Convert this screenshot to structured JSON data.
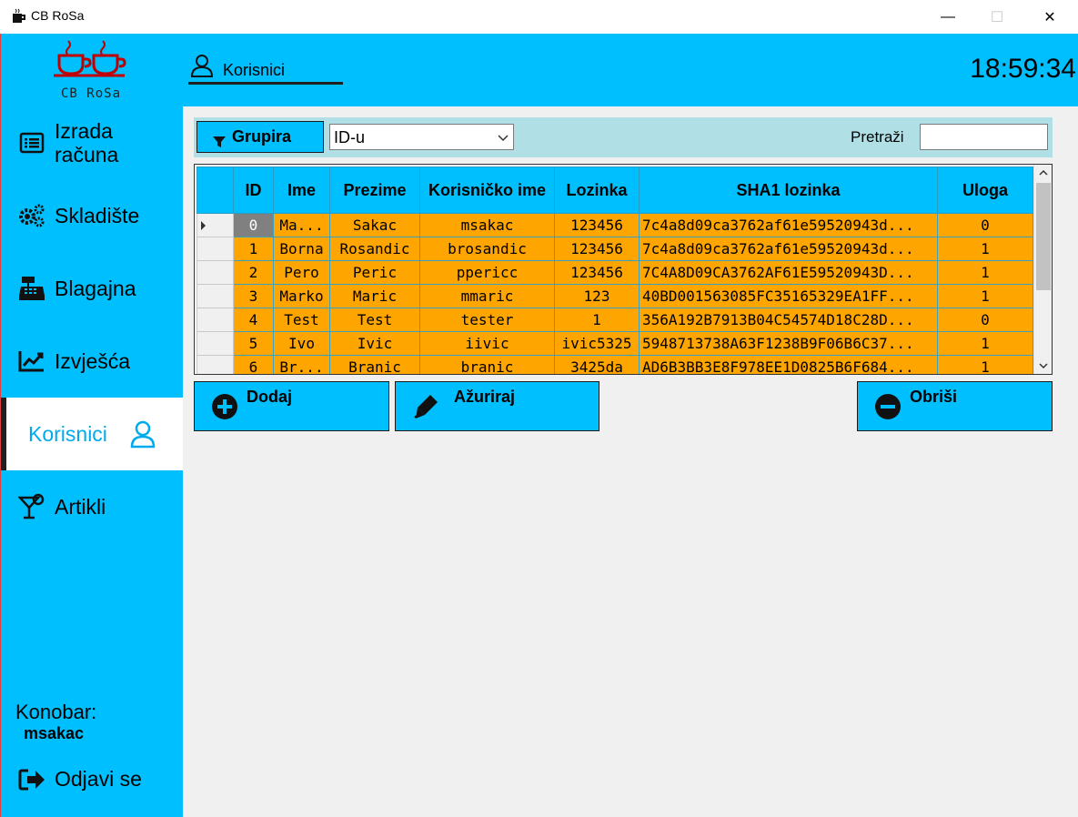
{
  "window": {
    "title": "CB RoSa",
    "minimize": "—",
    "maximize": "☐",
    "close": "✕"
  },
  "sidebar": {
    "logo_text": "CB RoSa",
    "items": [
      {
        "label_line1": "Izrada",
        "label_line2": "računa",
        "icon": "receipt-list-icon"
      },
      {
        "label": "Skladište",
        "icon": "gears-icon"
      },
      {
        "label": "Blagajna",
        "icon": "cash-register-icon"
      },
      {
        "label": "Izvješća",
        "icon": "line-chart-icon"
      },
      {
        "label": "Korisnici",
        "icon": "user-icon",
        "active": true
      },
      {
        "label": "Artikli",
        "icon": "cocktail-glass-icon"
      }
    ],
    "waiter_label": "Konobar:",
    "waiter_name": "msakac",
    "logout_label": "Odjavi se"
  },
  "header": {
    "page_title": "Korisnici",
    "clock": "18:59:34"
  },
  "filter": {
    "group_label": "Grupira",
    "group_by_value": "ID-u",
    "search_label": "Pretraži",
    "search_value": ""
  },
  "table": {
    "columns": [
      "ID",
      "Ime",
      "Prezime",
      "Korisničko ime",
      "Lozinka",
      "SHA1 lozinka",
      "Uloga"
    ],
    "rows": [
      [
        "0",
        "Ma...",
        "Sakac",
        "msakac",
        "123456",
        "7c4a8d09ca3762af61e59520943d...",
        "0"
      ],
      [
        "1",
        "Borna",
        "Rosandic",
        "brosandic",
        "123456",
        "7c4a8d09ca3762af61e59520943d...",
        "1"
      ],
      [
        "2",
        "Pero",
        "Peric",
        "ppericc",
        "123456",
        "7C4A8D09CA3762AF61E59520943D...",
        "1"
      ],
      [
        "3",
        "Marko",
        "Maric",
        "mmaric",
        "123",
        "40BD001563085FC35165329EA1FF...",
        "1"
      ],
      [
        "4",
        "Test",
        "Test",
        "tester",
        "1",
        "356A192B7913B04C54574D18C28D...",
        "0"
      ],
      [
        "5",
        "Ivo",
        "Ivic",
        "iivic",
        "ivic5325",
        "5948713738A63F1238B9F06B6C37...",
        "1"
      ],
      [
        "6",
        "Br...",
        "Branic",
        "branic",
        "3425da",
        "AD6B3BB3E8F978EE1D0825B6F684...",
        "1"
      ]
    ],
    "selected_row": 0
  },
  "actions": {
    "add": "Dodaj",
    "edit": "Ažuriraj",
    "delete": "Obriši"
  },
  "colors": {
    "accent": "#00bfff",
    "row_bg": "#ffa500",
    "filter_bg": "#b0e0e6",
    "active_text": "#00aaee",
    "logo_red": "#c00000"
  }
}
